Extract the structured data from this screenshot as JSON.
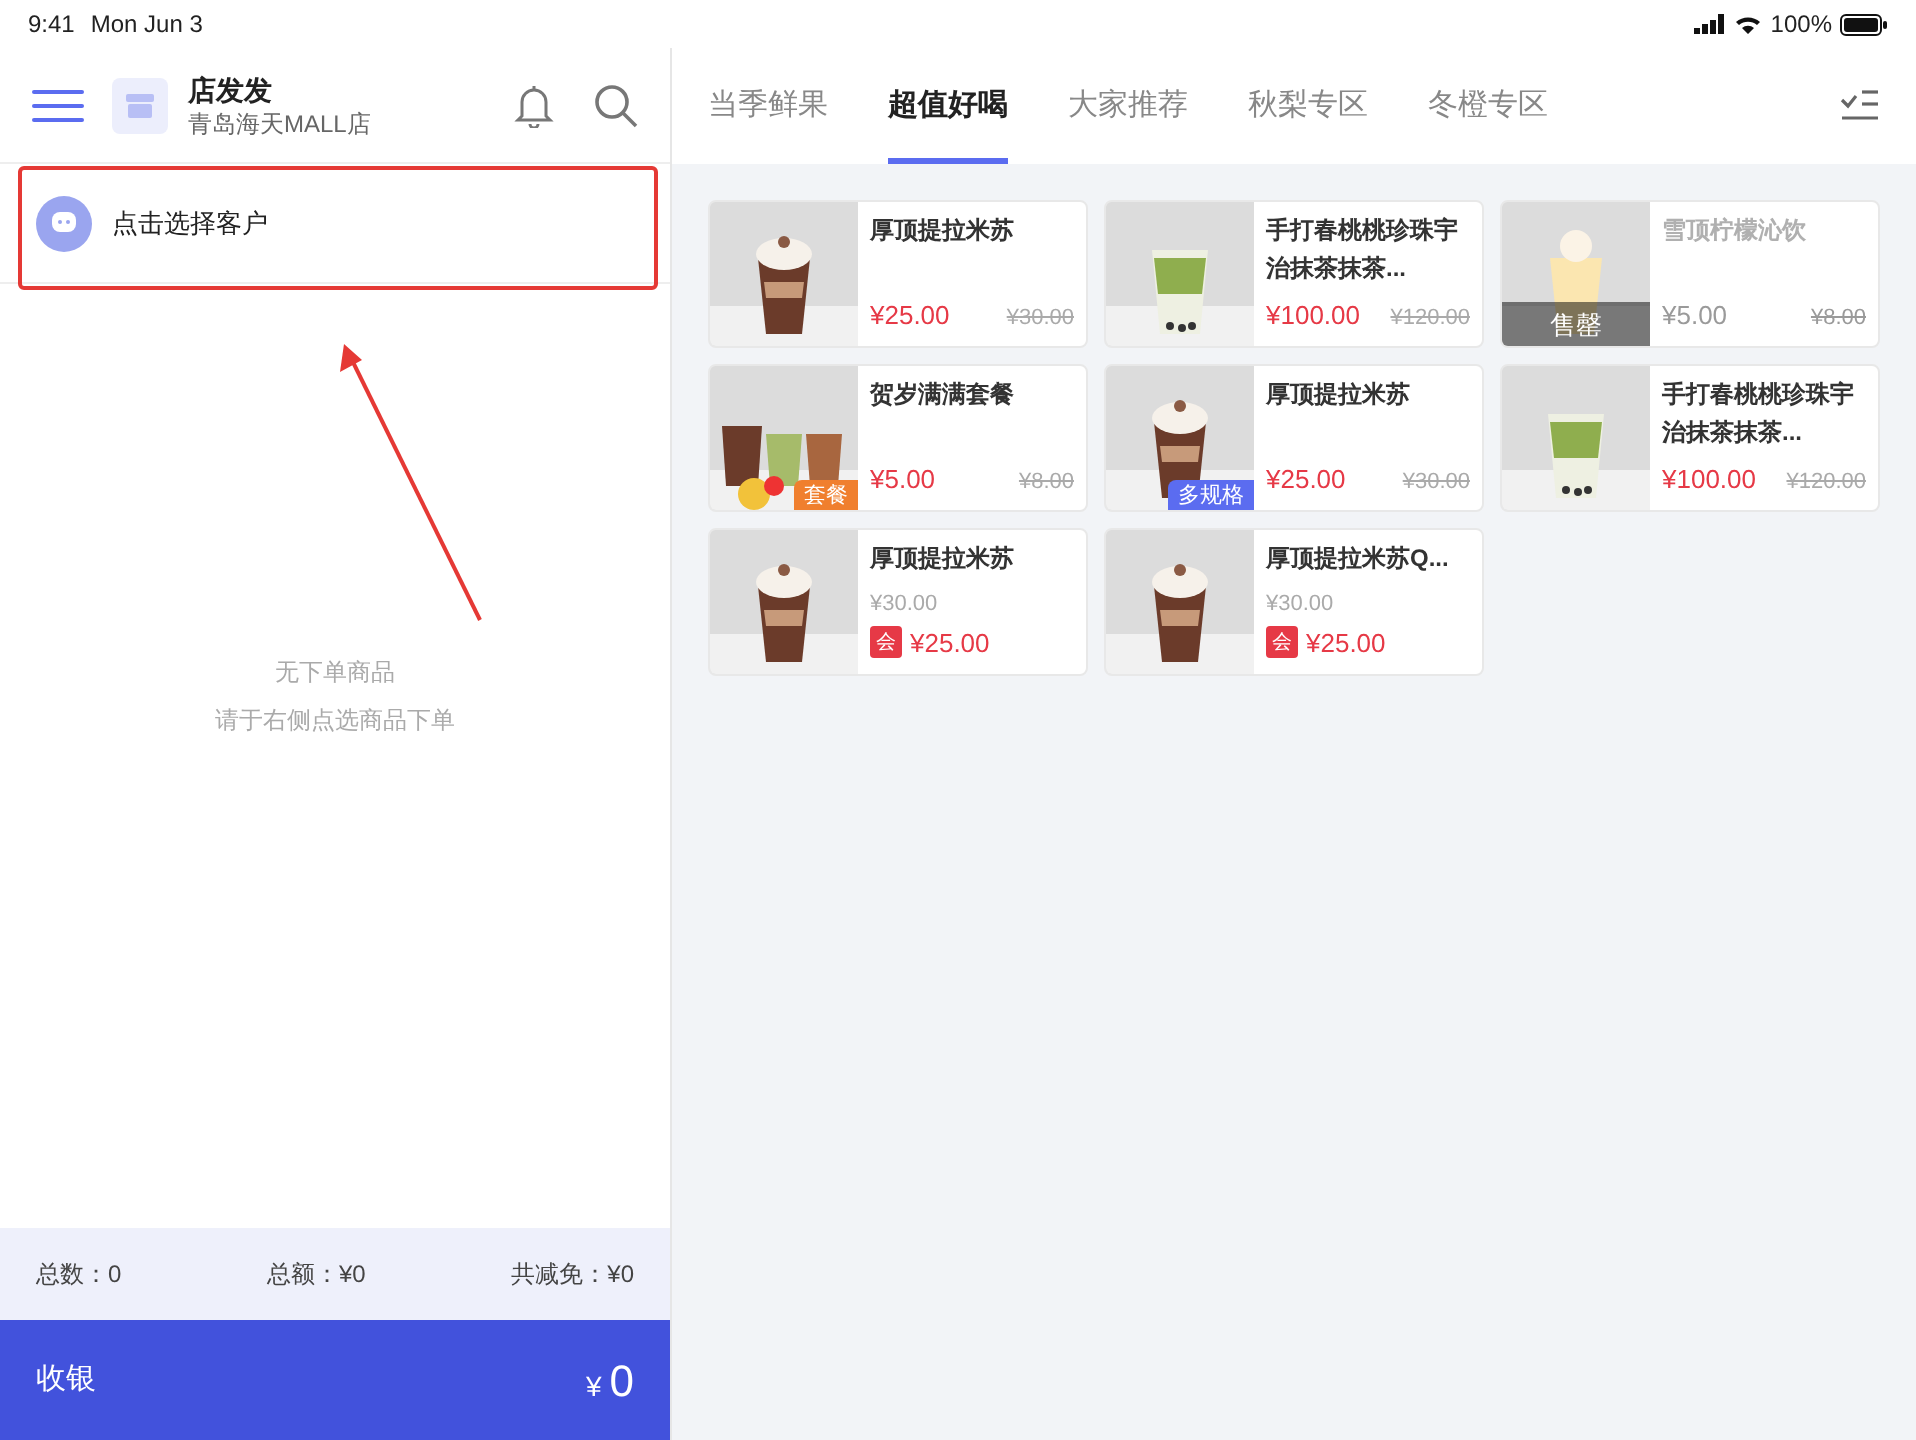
{
  "status_bar": {
    "time": "9:41",
    "date": "Mon Jun 3",
    "battery_text": "100%"
  },
  "store": {
    "name": "店发发",
    "branch": "青岛海天MALL店"
  },
  "customer": {
    "label": "点击选择客户"
  },
  "cart": {
    "empty_title": "无下单商品",
    "empty_hint": "请于右侧点选商品下单"
  },
  "summary": [
    {
      "label": "总数：0"
    },
    {
      "label": "总额：¥0"
    },
    {
      "label": "共减免：¥0"
    }
  ],
  "checkout": {
    "label": "收银",
    "currency": "¥",
    "amount": "0"
  },
  "tabs": [
    {
      "label": "当季鲜果",
      "selected": false
    },
    {
      "label": "超值好喝",
      "selected": true
    },
    {
      "label": "大家推荐",
      "selected": false
    },
    {
      "label": "秋梨专区",
      "selected": false
    },
    {
      "label": "冬橙专区",
      "selected": false
    }
  ],
  "products": [
    {
      "kind": "regular",
      "photo": {
        "kind": "mocha"
      },
      "name": "厚顶提拉米苏",
      "price": "¥25.00",
      "original_price": "¥30.00",
      "sold_out": false
    },
    {
      "kind": "regular",
      "photo": {
        "kind": "matcha"
      },
      "name": "手打春桃桃珍珠宇治抹茶抹茶...",
      "price": "¥100.00",
      "original_price": "¥120.00",
      "sold_out": false
    },
    {
      "kind": "regular",
      "photo": {
        "kind": "lemon"
      },
      "name": "雪顶柠檬沁饮",
      "price": "¥5.00",
      "original_price": "¥8.00",
      "sold_out": true,
      "sold_out_text": "售罄"
    },
    {
      "kind": "regular",
      "photo": {
        "kind": "combo"
      },
      "name": "贺岁满满套餐",
      "price": "¥5.00",
      "original_price": "¥8.00",
      "sold_out": false,
      "tag": {
        "text": "套餐",
        "color": "#f07f2e"
      }
    },
    {
      "kind": "regular",
      "photo": {
        "kind": "mocha"
      },
      "name": "厚顶提拉米苏",
      "price": "¥25.00",
      "original_price": "¥30.00",
      "sold_out": false,
      "tag": {
        "text": "多规格",
        "color": "#5b6cf0"
      }
    },
    {
      "kind": "regular",
      "photo": {
        "kind": "matcha"
      },
      "name": "手打春桃桃珍珠宇治抹茶抹茶...",
      "price": "¥100.00",
      "original_price": "¥120.00",
      "sold_out": false
    },
    {
      "kind": "member",
      "photo": {
        "kind": "mocha"
      },
      "name": "厚顶提拉米苏",
      "price": "¥25.00",
      "original_price": "¥30.00",
      "member_badge": "会",
      "sold_out": false
    },
    {
      "kind": "member",
      "photo": {
        "kind": "mocha"
      },
      "name": "厚顶提拉米苏Q...",
      "price": "¥25.00",
      "original_price": "¥30.00",
      "member_badge": "会",
      "sold_out": false
    }
  ]
}
